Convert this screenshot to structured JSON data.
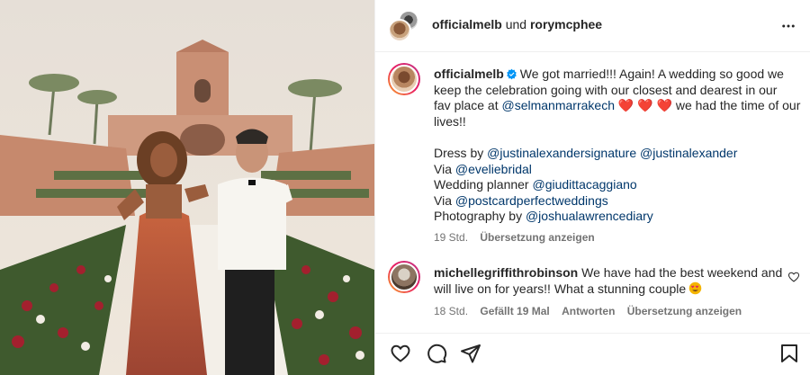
{
  "post_header": {
    "username": "officialmelb",
    "joiner": "und",
    "collaborator": "rorymcphee",
    "more_icon": "more-horizontal-icon"
  },
  "caption": {
    "username": "officialmelb",
    "verified_icon": "verified-badge-icon",
    "line1": "We got married!!! Again! A wedding so good we",
    "line2": "keep the celebration going with our closest and dearest in our",
    "line3_pre": "fav place at",
    "line3_mention": "@selmanmarrakech",
    "line3_hearts": "❤️ ❤️ ❤️",
    "line3_post": "we had the time of our",
    "line4": "lives!!",
    "credits": [
      {
        "label": "Dress by",
        "mentions": [
          "@justinalexandersignature",
          "@justinalexander"
        ]
      },
      {
        "label": "Via",
        "mentions": [
          "@eveliebridal"
        ]
      },
      {
        "label": "Wedding planner",
        "mentions": [
          "@giudittacaggiano"
        ]
      },
      {
        "label": "Via",
        "mentions": [
          "@postcardperfectweddings"
        ]
      },
      {
        "label": "Photography by",
        "mentions": [
          "@joshualawrencediary"
        ]
      }
    ],
    "time": "19 Std.",
    "translate": "Übersetzung anzeigen"
  },
  "comment": {
    "username": "michellegriffithrobinson",
    "line1": "We have had the best weekend and",
    "line2": "will live on for years!! What a stunning couple",
    "emoji": "smiling-face-with-heart-eyes",
    "time": "18 Std.",
    "likes": "Gefällt 19 Mal",
    "reply": "Antworten",
    "translate": "Übersetzung anzeigen",
    "like_icon": "heart-outline-icon"
  },
  "actions": {
    "like_icon": "heart-outline-icon",
    "comment_icon": "comment-bubble-icon",
    "share_icon": "paper-plane-icon",
    "save_icon": "bookmark-icon"
  },
  "colors": {
    "mention": "#00376b",
    "meta": "#737373",
    "text": "#262626",
    "heart": "#e0245e"
  }
}
